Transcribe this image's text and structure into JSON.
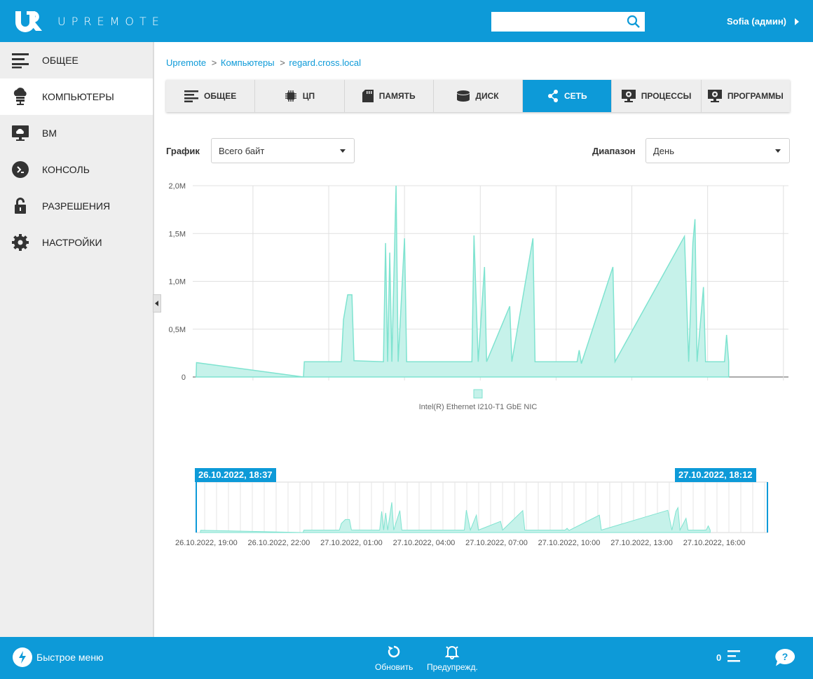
{
  "app": {
    "brand": "UPREMOTE",
    "user": "Sofia (админ)"
  },
  "search": {
    "value": "",
    "placeholder": ""
  },
  "sidebar": {
    "items": [
      {
        "label": "ОБЩЕЕ",
        "icon": "list-icon",
        "active": false
      },
      {
        "label": "КОМПЬЮТЕРЫ",
        "icon": "computers-icon",
        "active": true
      },
      {
        "label": "ВМ",
        "icon": "vm-icon",
        "active": false
      },
      {
        "label": "КОНСОЛЬ",
        "icon": "console-icon",
        "active": false
      },
      {
        "label": "РАЗРЕШЕНИЯ",
        "icon": "lock-icon",
        "active": false
      },
      {
        "label": "НАСТРОЙКИ",
        "icon": "gear-icon",
        "active": false
      }
    ]
  },
  "breadcrumb": [
    "Upremote",
    "Компьютеры",
    "regard.cross.local"
  ],
  "tabs": [
    {
      "label": "ОБЩЕЕ",
      "icon": "list-icon",
      "active": false
    },
    {
      "label": "ЦП",
      "icon": "cpu-icon",
      "active": false
    },
    {
      "label": "ПАМЯТЬ",
      "icon": "memory-icon",
      "active": false
    },
    {
      "label": "ДИСК",
      "icon": "disk-icon",
      "active": false
    },
    {
      "label": "СЕТЬ",
      "icon": "network-icon",
      "active": true
    },
    {
      "label": "ПРОЦЕССЫ",
      "icon": "processes-icon",
      "active": false
    },
    {
      "label": "ПРОГРАММЫ",
      "icon": "programs-icon",
      "active": false
    }
  ],
  "controls": {
    "graph_label": "График",
    "graph_value": "Всего байт",
    "range_label": "Диапазон",
    "range_value": "День"
  },
  "colors": {
    "accent": "#0d9ad8",
    "series": "#7fe3d0",
    "series_fill": "#c6f2ea"
  },
  "chart_data": {
    "type": "area",
    "title": "",
    "xlabel": "",
    "ylabel": "",
    "yticks": [
      "0",
      "0,5M",
      "1,0M",
      "1,5M",
      "2,0M"
    ],
    "ylim": [
      0,
      2.0
    ],
    "y_unit": "M",
    "grid": true,
    "legend": {
      "position": "bottom",
      "entries": [
        "Intel(R) Ethernet I210-T1 GbE NIC"
      ]
    },
    "series": [
      {
        "name": "Intel(R) Ethernet I210-T1 GbE NIC",
        "points": [
          [
            "26.10.2022, 18:45",
            0.0
          ],
          [
            "26.10.2022, 18:46",
            0.15
          ],
          [
            "26.10.2022, 23:00",
            0.0
          ],
          [
            "26.10.2022, 23:02",
            0.16
          ],
          [
            "27.10.2022, 00:30",
            0.16
          ],
          [
            "27.10.2022, 00:35",
            0.6
          ],
          [
            "27.10.2022, 00:45",
            0.86
          ],
          [
            "27.10.2022, 00:55",
            0.86
          ],
          [
            "27.10.2022, 01:00",
            0.17
          ],
          [
            "27.10.2022, 02:10",
            0.16
          ],
          [
            "27.10.2022, 02:15",
            1.4
          ],
          [
            "27.10.2022, 02:20",
            0.16
          ],
          [
            "27.10.2022, 02:25",
            1.3
          ],
          [
            "27.10.2022, 02:30",
            0.16
          ],
          [
            "27.10.2022, 02:40",
            2.0
          ],
          [
            "27.10.2022, 02:45",
            0.16
          ],
          [
            "27.10.2022, 03:00",
            1.45
          ],
          [
            "27.10.2022, 03:05",
            0.16
          ],
          [
            "27.10.2022, 05:40",
            0.16
          ],
          [
            "27.10.2022, 05:45",
            1.48
          ],
          [
            "27.10.2022, 05:55",
            0.16
          ],
          [
            "27.10.2022, 06:10",
            1.15
          ],
          [
            "27.10.2022, 06:15",
            0.16
          ],
          [
            "27.10.2022, 07:10",
            0.74
          ],
          [
            "27.10.2022, 07:15",
            0.16
          ],
          [
            "27.10.2022, 08:05",
            1.45
          ],
          [
            "27.10.2022, 08:10",
            0.16
          ],
          [
            "27.10.2022, 09:50",
            0.16
          ],
          [
            "27.10.2022, 09:55",
            0.28
          ],
          [
            "27.10.2022, 10:00",
            0.14
          ],
          [
            "27.10.2022, 11:15",
            1.15
          ],
          [
            "27.10.2022, 11:20",
            0.16
          ],
          [
            "27.10.2022, 14:05",
            1.47
          ],
          [
            "27.10.2022, 14:15",
            0.16
          ],
          [
            "27.10.2022, 14:25",
            1.4
          ],
          [
            "27.10.2022, 14:30",
            1.65
          ],
          [
            "27.10.2022, 14:35",
            0.16
          ],
          [
            "27.10.2022, 14:50",
            0.94
          ],
          [
            "27.10.2022, 14:55",
            0.16
          ],
          [
            "27.10.2022, 15:40",
            0.16
          ],
          [
            "27.10.2022, 15:45",
            0.44
          ],
          [
            "27.10.2022, 15:50",
            0.16
          ]
        ]
      }
    ],
    "navigator": {
      "range_start": "26.10.2022, 18:37",
      "range_end": "27.10.2022, 18:12",
      "xticks": [
        "26.10.2022, 19:00",
        "26.10.2022, 22:00",
        "27.10.2022, 01:00",
        "27.10.2022, 04:00",
        "27.10.2022, 07:00",
        "27.10.2022, 10:00",
        "27.10.2022, 13:00",
        "27.10.2022, 16:00"
      ]
    }
  },
  "footer": {
    "quick_menu": "Быстрое меню",
    "refresh": "Обновить",
    "alerts": "Предупрежд.",
    "count": "0"
  }
}
